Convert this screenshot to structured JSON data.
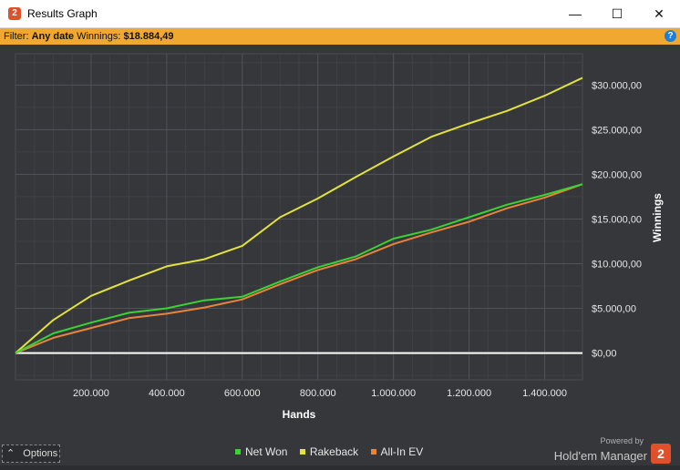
{
  "window": {
    "title": "Results Graph",
    "app_icon": "2",
    "minimize_glyph": "—",
    "maximize_glyph": "☐",
    "close_glyph": "✕"
  },
  "filter_bar": {
    "filter_label": "Filter:",
    "filter_value": "Any date",
    "winnings_label": "Winnings:",
    "winnings_value": "$18.884,49",
    "help_glyph": "?"
  },
  "colors": {
    "net_won": "#39d333",
    "rakeback": "#e3e33a",
    "allin_ev": "#e7843b",
    "zero_line": "#ffffff",
    "filter_bar": "#f0a830",
    "brand": "#e0502a"
  },
  "chart_data": {
    "type": "line",
    "xlabel": "Hands",
    "ylabel": "Winnings",
    "xlim": [
      0,
      1500000
    ],
    "ylim": [
      -3000,
      33500
    ],
    "x_ticks": [
      200000,
      400000,
      600000,
      800000,
      1000000,
      1200000,
      1400000
    ],
    "x_tick_labels": [
      "200.000",
      "400.000",
      "600.000",
      "800.000",
      "1.000.000",
      "1.200.000",
      "1.400.000"
    ],
    "y_ticks": [
      0,
      5000,
      10000,
      15000,
      20000,
      25000,
      30000
    ],
    "y_tick_labels": [
      "$0,00",
      "$5.000,00",
      "$10.000,00",
      "$15.000,00",
      "$20.000,00",
      "$25.000,00",
      "$30.000,00"
    ],
    "grid": true,
    "legend_position": "bottom",
    "x": [
      0,
      100000,
      200000,
      300000,
      400000,
      500000,
      600000,
      700000,
      800000,
      900000,
      1000000,
      1100000,
      1200000,
      1300000,
      1400000,
      1500000
    ],
    "series": [
      {
        "name": "Net Won",
        "values": [
          0,
          2200,
          3400,
          4500,
          5000,
          5900,
          6300,
          8000,
          9600,
          10800,
          12800,
          13800,
          15200,
          16600,
          17700,
          18900
        ]
      },
      {
        "name": "Rakeback",
        "values": [
          0,
          3700,
          6400,
          8100,
          9700,
          10500,
          12000,
          15200,
          17300,
          19700,
          22000,
          24200,
          25700,
          27100,
          28800,
          30800
        ]
      },
      {
        "name": "All-In EV",
        "values": [
          0,
          1700,
          2800,
          3900,
          4400,
          5100,
          6000,
          7700,
          9300,
          10500,
          12200,
          13500,
          14700,
          16200,
          17400,
          18900
        ]
      }
    ]
  },
  "footer": {
    "options_label": "Options",
    "options_glyph": "⌃",
    "powered_by": "Powered by",
    "brand_name": "Hold'em Manager",
    "brand_logo": "2"
  }
}
